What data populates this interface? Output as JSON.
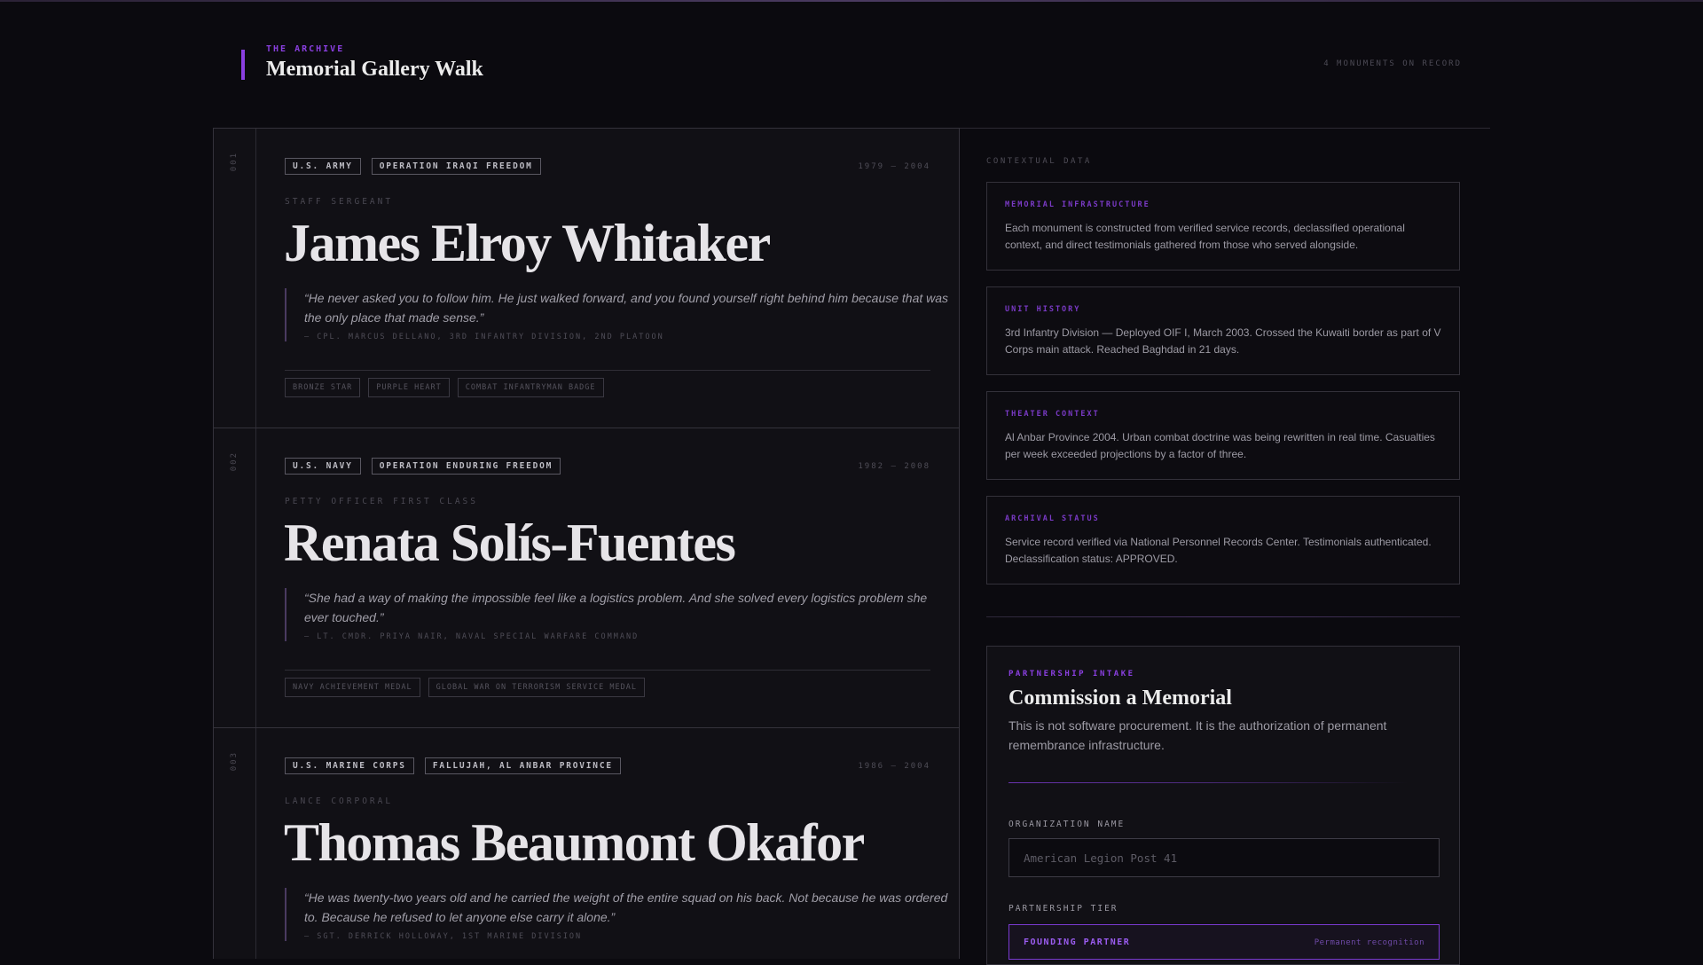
{
  "header": {
    "eyebrow": "THE ARCHIVE",
    "title": "Memorial Gallery Walk",
    "count": "4 MONUMENTS ON RECORD"
  },
  "memorials": [
    {
      "num": "001",
      "branch": "U.S. ARMY",
      "operation": "OPERATION IRAQI FREEDOM",
      "years": "1979 — 2004",
      "rank": "STAFF SERGEANT",
      "name": "James Elroy Whitaker",
      "quote": "“He never asked you to follow him. He just walked forward, and you found yourself right behind him because that was the only place that made sense.”",
      "attribution": "— CPL. MARCUS DELLANO, 3RD INFANTRY DIVISION, 2ND PLATOON",
      "awards": [
        "BRONZE STAR",
        "PURPLE HEART",
        "COMBAT INFANTRYMAN BADGE"
      ]
    },
    {
      "num": "002",
      "branch": "U.S. NAVY",
      "operation": "OPERATION ENDURING FREEDOM",
      "years": "1982 — 2008",
      "rank": "PETTY OFFICER FIRST CLASS",
      "name": "Renata Solís-Fuentes",
      "quote": "“She had a way of making the impossible feel like a logistics problem. And she solved every logistics problem she ever touched.”",
      "attribution": "— LT. CMDR. PRIYA NAIR, NAVAL SPECIAL WARFARE COMMAND",
      "awards": [
        "NAVY ACHIEVEMENT MEDAL",
        "GLOBAL WAR ON TERRORISM SERVICE MEDAL"
      ]
    },
    {
      "num": "003",
      "branch": "U.S. MARINE CORPS",
      "operation": "FALLUJAH, AL ANBAR PROVINCE",
      "years": "1986 — 2004",
      "rank": "LANCE CORPORAL",
      "name": "Thomas Beaumont Okafor",
      "quote": "“He was twenty-two years old and he carried the weight of the entire squad on his back. Not because he was ordered to. Because he refused to let anyone else carry it alone.”",
      "attribution": "— SGT. DERRICK HOLLOWAY, 1ST MARINE DIVISION",
      "awards": []
    }
  ],
  "context": {
    "label": "CONTEXTUAL DATA",
    "cards": [
      {
        "title": "MEMORIAL INFRASTRUCTURE",
        "body": "Each monument is constructed from verified service records, declassified operational context, and direct testimonials gathered from those who served alongside."
      },
      {
        "title": "UNIT HISTORY",
        "body": "3rd Infantry Division — Deployed OIF I, March 2003. Crossed the Kuwaiti border as part of V Corps main attack. Reached Baghdad in 21 days."
      },
      {
        "title": "THEATER CONTEXT",
        "body": "Al Anbar Province 2004. Urban combat doctrine was being rewritten in real time. Casualties per week exceeded projections by a factor of three."
      },
      {
        "title": "ARCHIVAL STATUS",
        "body": "Service record verified via National Personnel Records Center. Testimonials authenticated. Declassification status: APPROVED."
      }
    ]
  },
  "intake": {
    "label": "PARTNERSHIP INTAKE",
    "title": "Commission a Memorial",
    "description": "This is not software procurement. It is the authorization of permanent remembrance infrastructure.",
    "org_label": "ORGANIZATION NAME",
    "org_placeholder": "American Legion Post 41",
    "org_value": "",
    "tier_label": "PARTNERSHIP TIER",
    "tier_selected": "FOUNDING PARTNER",
    "tier_note": "Permanent recognition"
  },
  "colors": {
    "accent": "#8a3fe0",
    "background": "#0b0a0f",
    "card": "#111015"
  }
}
